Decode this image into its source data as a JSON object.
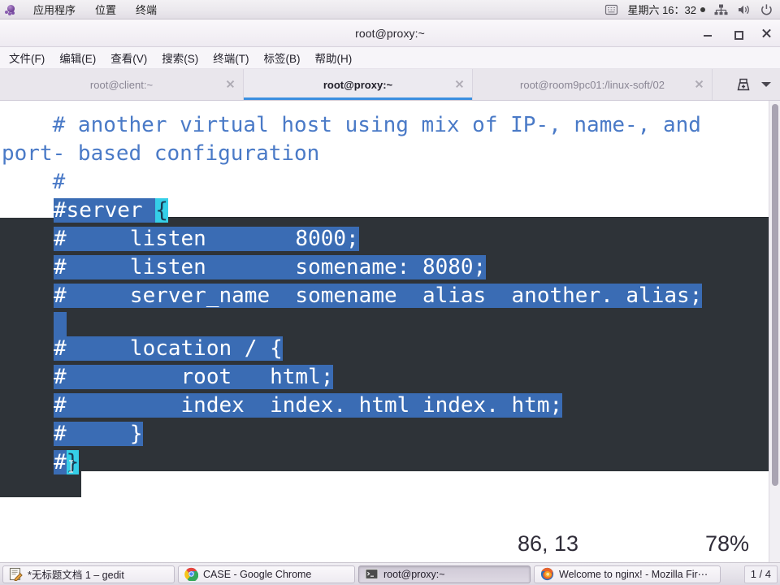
{
  "panel": {
    "logo_icon": "gnome-foot-icon",
    "menus": [
      "应用程序",
      "位置",
      "终端"
    ],
    "keyboard_icon": "keyboard-indicator-icon",
    "clock": "星期六 16：32",
    "record_dot": "recording-dot-icon",
    "network_icon": "network-wired-icon",
    "volume_icon": "volume-speaker-icon",
    "power_icon": "power-button-icon"
  },
  "window": {
    "title": "root@proxy:~",
    "minimize_icon": "minimize-icon",
    "maximize_icon": "maximize-icon",
    "close_icon": "close-icon"
  },
  "menubar": {
    "items": [
      "文件(F)",
      "编辑(E)",
      "查看(V)",
      "搜索(S)",
      "终端(T)",
      "标签(B)",
      "帮助(H)"
    ]
  },
  "tabs": {
    "items": [
      {
        "label": "root@client:~",
        "active": false,
        "close_icon": "tab-close-icon"
      },
      {
        "label": "root@proxy:~",
        "active": true,
        "close_icon": "tab-close-icon"
      },
      {
        "label": "root@room9pc01:/linux-soft/02",
        "active": false,
        "close_icon": "tab-close-icon"
      }
    ],
    "new_tab_icon": "new-tab-icon",
    "tab_list_icon": "chevron-down-icon"
  },
  "terminal": {
    "lines": {
      "l1": "    # another virtual host using mix of IP-, name-, and",
      "l2": "port- based configuration",
      "l3": "    #",
      "l4_prefix": "#server ",
      "l4_cursor": "{",
      "l5": "#     listen       8000;",
      "l6": "#     listen       somename: 8080;",
      "l7": "#     server_name  somename  alias  another. alias;",
      "l8": "#     location / {",
      "l9": "#         root   html;",
      "l10": "#         index  index. html index. htm;",
      "l11": "#     }",
      "l12_prefix": "#",
      "l12_cursor": "}"
    },
    "status": {
      "position": "86, 13",
      "percent": "78%"
    },
    "colors": {
      "comment_blue": "#4a7ac7",
      "selection_blue": "#3a6cb4",
      "cursor_cyan": "#35cfe8",
      "dark_background": "#2e3338"
    },
    "mouse_cursor_icon": "text-ibeam-cursor"
  },
  "taskbar": {
    "items": [
      {
        "label": "*无标题文档 1 – gedit",
        "icon": "gedit-icon",
        "active": false
      },
      {
        "label": "CASE - Google Chrome",
        "icon": "chrome-icon",
        "active": false
      },
      {
        "label": "root@proxy:~",
        "icon": "terminal-icon",
        "active": true
      },
      {
        "label": "Welcome to nginx! - Mozilla Fir⋯",
        "icon": "firefox-icon",
        "active": false
      }
    ],
    "workspace_indicator": "1 / 4"
  }
}
